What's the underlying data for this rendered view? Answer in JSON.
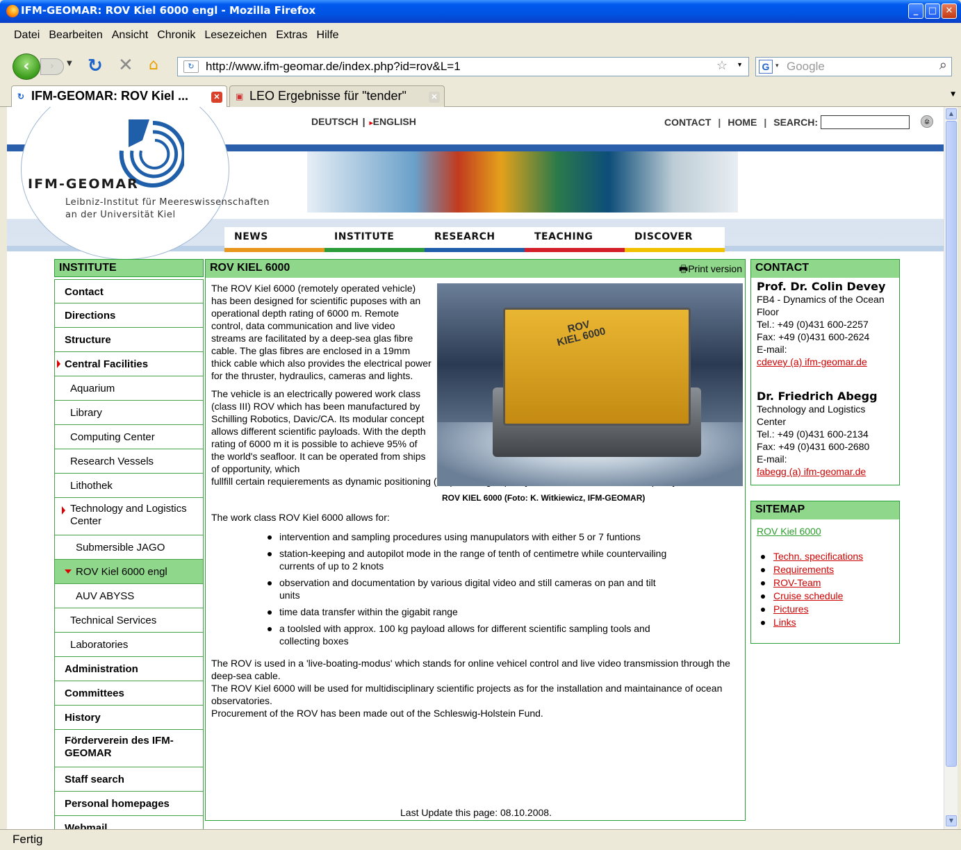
{
  "window": {
    "title": "IFM-GEOMAR: ROV Kiel 6000 engl - Mozilla Firefox"
  },
  "menu": [
    "Datei",
    "Bearbeiten",
    "Ansicht",
    "Chronik",
    "Lesezeichen",
    "Extras",
    "Hilfe"
  ],
  "nav": {
    "url": "http://www.ifm-geomar.de/index.php?id=rov&L=1",
    "search_placeholder": "Google"
  },
  "tabs": [
    {
      "label": "IFM-GEOMAR: ROV Kiel ..."
    },
    {
      "label": "LEO Ergebnisse für \"tender\""
    }
  ],
  "status": "Fertig",
  "site": {
    "logo_name": "IFM-GEOMAR",
    "logo_sub1": "Leibniz-Institut für Meereswissenschaften",
    "logo_sub2": "an der Universität Kiel",
    "lang_de": "DEUTSCH",
    "lang_en": "ENGLISH",
    "top_contact": "CONTACT",
    "top_home": "HOME",
    "top_search": "SEARCH:",
    "main_nav": [
      {
        "label": "NEWS",
        "color": "#e9961d"
      },
      {
        "label": "INSTITUTE",
        "color": "#2c9c3a"
      },
      {
        "label": "RESEARCH",
        "color": "#1f5ea8"
      },
      {
        "label": "TEACHING",
        "color": "#d21f2a"
      },
      {
        "label": "DISCOVER",
        "color": "#f2c200"
      }
    ]
  },
  "left": {
    "head": "INSTITUTE",
    "items": [
      {
        "label": "Contact"
      },
      {
        "label": "Directions"
      },
      {
        "label": "Structure"
      },
      {
        "label": "Central Facilities"
      },
      {
        "label": "Aquarium"
      },
      {
        "label": "Library"
      },
      {
        "label": "Computing Center"
      },
      {
        "label": "Research Vessels"
      },
      {
        "label": "Lithothek"
      },
      {
        "label": "Technology and Logistics Center"
      },
      {
        "label": "Submersible JAGO"
      },
      {
        "label": "ROV Kiel 6000 engl"
      },
      {
        "label": "AUV ABYSS"
      },
      {
        "label": "Technical Services"
      },
      {
        "label": "Laboratories"
      },
      {
        "label": "Administration"
      },
      {
        "label": "Committees"
      },
      {
        "label": "History"
      },
      {
        "label": "Förderverein des IFM-GEOMAR"
      },
      {
        "label": "Staff search"
      },
      {
        "label": "Personal homepages"
      },
      {
        "label": "Webmail"
      }
    ]
  },
  "main": {
    "head": "ROV KIEL 6000",
    "print": "Print version",
    "p1": "The ROV Kiel 6000 (remotely operated vehicle) has been designed for scientific puposes with an operational depth rating of 6000 m. Remote control, data communication and live video streams are facilitated by a deep-sea glas fibre cable. The glas fibres are enclosed in a 19mm thick cable which also provides the electrical power for the thruster, hydraulics, cameras and lights.",
    "p2a": "The vehicle is an electrically powered work class (class III) ROV which has been manufactured by Schilling Robotics, Davic/CA. Its modular concept allows different scientific payloads. With the depth rating of 6000 m it is possible to achieve 95% of the world's seafloor. It can be operated from ships of opportunity, which",
    "p2b": "fullfill certain requierements as dynamic positioning (DP), bearing capacity, electric and crane/winch capacity.",
    "photo_label": "ROV\nKIEL 6000",
    "caption": "ROV KIEL 6000 (Foto: K. Witkiewicz, IFM-GEOMAR)",
    "intro": "The work class ROV Kiel 6000 allows for:",
    "bullets": [
      "intervention and sampling procedures using manupulators with either 5 or 7 funtions",
      "station-keeping and autopilot mode in the range of tenth of centimetre while countervailing currents of up to 2 knots",
      "observation and documentation by various digital video and still cameras on pan and tilt units",
      "time data transfer within the gigabit range",
      " a toolsled with approx. 100 kg payload allows for different scientific sampling tools and collecting boxes"
    ],
    "p3": "The ROV is used in a 'live-boating-modus' which stands for online vehicel control and live video transmission through the deep-sea cable.",
    "p4": "The ROV Kiel 6000 will be used for multidisciplinary scientific projects as for the installation and maintainance of ocean observatories.",
    "p5": "Procurement of the ROV has been made out of the Schleswig-Holstein Fund.",
    "last_update": "Last Update this page: 08.10.2008."
  },
  "contact": {
    "head": "CONTACT",
    "p1": {
      "name": "Prof. Dr. Colin Devey",
      "dept": "FB4 - Dynamics of the Ocean Floor",
      "tel": "Tel.: +49 (0)431 600-2257",
      "fax": "Fax: +49 (0)431 600-2624",
      "email_label": "E-mail:",
      "email": "cdevey (a) ifm-geomar.de"
    },
    "p2": {
      "name": "Dr. Friedrich Abegg",
      "dept": "Technology and Logistics Center",
      "tel": "Tel.: +49 (0)431 600-2134",
      "fax": "Fax: +49 (0)431 600-2680",
      "email_label": "E-mail:",
      "email": "fabegg (a) ifm-geomar.de"
    }
  },
  "sitemap": {
    "head": "SITEMAP",
    "top": "ROV Kiel 6000",
    "links": [
      "Techn. specifications",
      "Requirements",
      "ROV-Team",
      "Cruise schedule",
      "Pictures",
      "Links"
    ]
  }
}
